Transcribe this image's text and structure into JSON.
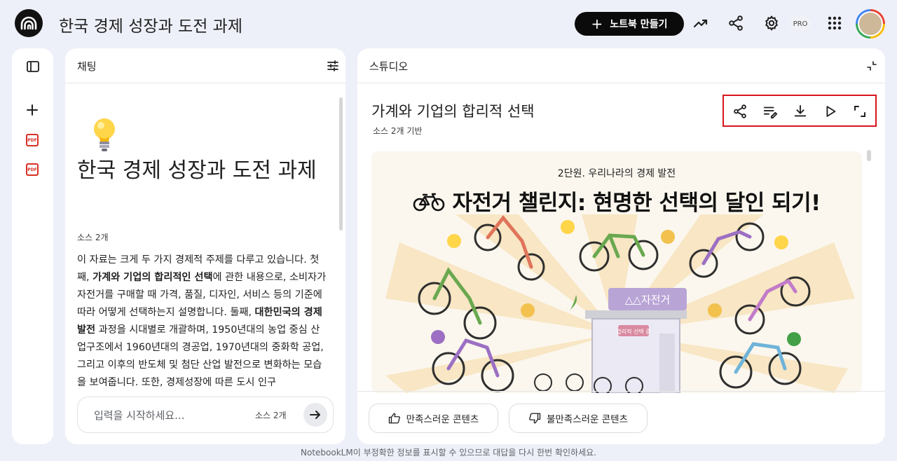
{
  "header": {
    "notebook_title": "한국 경제 성장과 도전 과제",
    "create_button_label": "노트북 만들기",
    "pro_badge": "PRO",
    "icons": [
      "analytics-icon",
      "share-icon",
      "settings-icon",
      "apps-grid-icon"
    ]
  },
  "sidebar": {
    "icons": [
      "sidebar-toggle-icon",
      "add-source-icon",
      "pdf-icon",
      "pdf-icon"
    ],
    "pdf_label": "PDF"
  },
  "chat": {
    "panel_title": "채팅",
    "title": "한국 경제 성장과 도전 과제",
    "sources_count": "소스 2개",
    "summary_parts": [
      "이 자료는 크게 두 가지 경제적 주제를 다루고 있습니다. 첫째, ",
      "가계와 기업의 합리적인 선택",
      "에 관한 내용으로, 소비자가 자전거를 구매할 때 가격, 품질, 디자인, 서비스 등의 기준에 따라 어떻게 선택하는지 설명합니다. 둘째, ",
      "대한민국의 경제 발전",
      " 과정을 시대별로 개괄하며, 1950년대의 농업 중심 산업구조에서 1960년대의 경공업, 1970년대의 중화학 공업, 그리고 이후의 반도체 및 첨단 산업 발전으로 변화하는 모습을 보여줍니다. 또한, 경제성장에 따른 도시 인구"
    ],
    "input_placeholder": "입력을 시작하세요...",
    "input_source_count": "소스 2개"
  },
  "studio": {
    "panel_title": "스튜디오",
    "content_title": "가계와 기업의 합리적 선택",
    "content_subtitle": "소스 2개 기반",
    "toolbar_icons": [
      "share-icon",
      "edit-notes-icon",
      "download-icon",
      "play-icon",
      "fullscreen-icon"
    ],
    "infographic": {
      "subtitle": "2단원. 우리나라의 경제 발전",
      "title": "자전거 챌린지: 현명한 선택의 달인 되기!",
      "shop_sign": "△△자전거",
      "shop_banner": "합리적 선택 중"
    },
    "feedback": {
      "positive": "만족스러운 콘텐츠",
      "negative": "불만족스러운 콘텐츠"
    }
  },
  "footer": {
    "disclaimer": "NotebookLM이 부정확한 정보를 표시할 수 있으므로 대답을 다시 한번 확인하세요."
  },
  "colors": {
    "background": "#eef0f9",
    "panel": "#ffffff",
    "highlight_border": "#d8151c",
    "pdf_red": "#d93025",
    "create_button": "#0b0b0b"
  }
}
